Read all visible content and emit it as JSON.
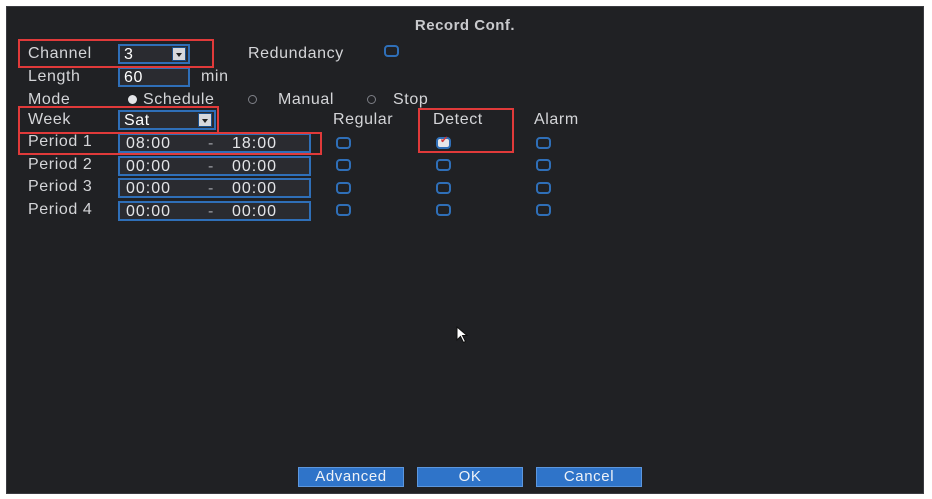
{
  "window": {
    "title": "Record Conf."
  },
  "channel": {
    "label": "Channel",
    "value": "3"
  },
  "redundancy": {
    "label": "Redundancy",
    "checked": false
  },
  "length": {
    "label": "Length",
    "value": "60",
    "unit": "min"
  },
  "mode": {
    "label": "Mode",
    "options": [
      "Schedule",
      "Manual",
      "Stop"
    ],
    "selected": "Schedule"
  },
  "week": {
    "label": "Week",
    "value": "Sat"
  },
  "columns": {
    "regular": "Regular",
    "detect": "Detect",
    "alarm": "Alarm"
  },
  "periods": [
    {
      "label": "Period 1",
      "start": "08:00",
      "end": "18:00",
      "regular": false,
      "detect": true,
      "alarm": false
    },
    {
      "label": "Period 2",
      "start": "00:00",
      "end": "00:00",
      "regular": false,
      "detect": false,
      "alarm": false
    },
    {
      "label": "Period 3",
      "start": "00:00",
      "end": "00:00",
      "regular": false,
      "detect": false,
      "alarm": false
    },
    {
      "label": "Period 4",
      "start": "00:00",
      "end": "00:00",
      "regular": false,
      "detect": false,
      "alarm": false
    }
  ],
  "time_separator": "-",
  "buttons": {
    "advanced": "Advanced",
    "ok": "OK",
    "cancel": "Cancel"
  },
  "colors": {
    "background": "#202124",
    "accent": "#2f74c9",
    "highlight": "#e03a3a"
  }
}
